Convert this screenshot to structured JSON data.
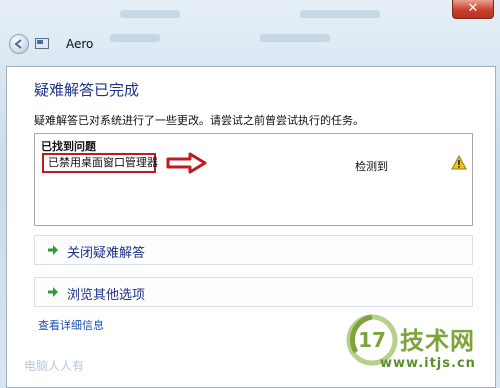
{
  "window": {
    "close_glyph": "✕",
    "title": "Aero"
  },
  "dialog": {
    "heading": "疑难解答已完成",
    "summary": "疑难解答已对系统进行了一些更改。请尝试之前曾尝试执行的任务。",
    "issues": {
      "header": "已找到问题",
      "items": [
        {
          "name": "已禁用桌面窗口管理器",
          "status": "检测到",
          "icon": "warning-icon"
        }
      ]
    },
    "options": [
      {
        "label": "关闭疑难解答",
        "icon": "green-arrow-icon"
      },
      {
        "label": "浏览其他选项",
        "icon": "green-arrow-icon"
      }
    ],
    "details_link": "查看详细信息"
  },
  "footer": {
    "text": "电脑人人有"
  },
  "watermark": {
    "logo_text": "17",
    "title": "技术网",
    "url": "www.itjs.cn"
  },
  "colors": {
    "heading": "#1e3287",
    "link": "#1c4fb0",
    "annotation_red": "#c3181f",
    "green_arrow": "#2e9a3a",
    "warning": "#f2c21b"
  }
}
